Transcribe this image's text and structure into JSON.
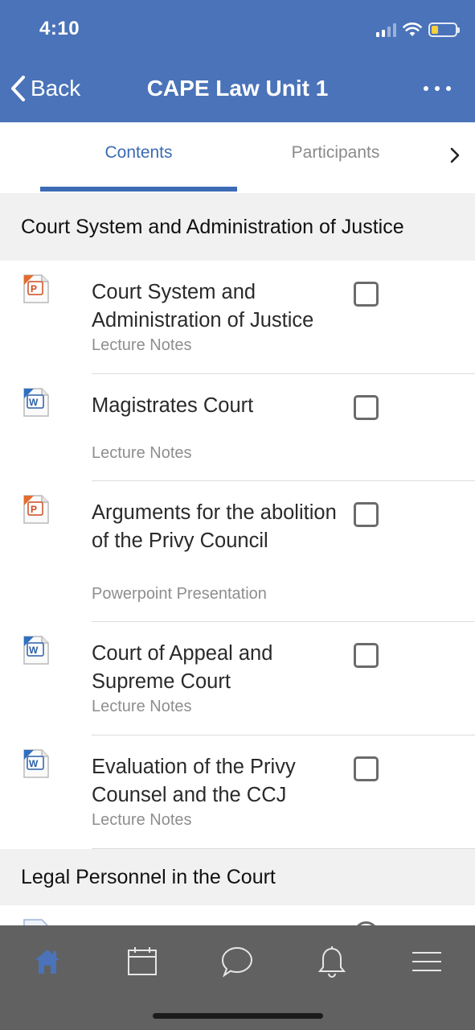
{
  "status_bar": {
    "time": "4:10"
  },
  "header": {
    "back_label": "Back",
    "title": "CAPE Law Unit 1"
  },
  "tabs": [
    {
      "label": "Contents",
      "active": true
    },
    {
      "label": "Participants",
      "active": false
    }
  ],
  "colors": {
    "header": "#4a73b9",
    "accent": "#3b6bb4",
    "bottom_nav": "#616161",
    "active_nav": "#4a73b9"
  },
  "sections": [
    {
      "title": "Court System and Administration of Justice",
      "items": [
        {
          "icon": "powerpoint-file-icon",
          "title": "Court System and Administration of Justice",
          "subtitle": "Lecture Notes",
          "checked": false
        },
        {
          "icon": "word-file-icon",
          "title": "Magistrates Court",
          "subtitle": "Lecture Notes",
          "checked": false
        },
        {
          "icon": "powerpoint-file-icon",
          "title": "Arguments for the abolition of the Privy Council",
          "subtitle": "Powerpoint Presentation",
          "checked": false
        },
        {
          "icon": "word-file-icon",
          "title": "Court of Appeal and Supreme Court",
          "subtitle": "Lecture Notes",
          "checked": false
        },
        {
          "icon": "word-file-icon",
          "title": "Evaluation of the Privy Counsel and the CCJ",
          "subtitle": "Lecture Notes",
          "checked": false
        }
      ]
    },
    {
      "title": "Legal Personnel in the Court"
    }
  ],
  "bottom_nav": [
    {
      "icon": "home-icon",
      "active": true
    },
    {
      "icon": "calendar-icon",
      "active": false
    },
    {
      "icon": "chat-icon",
      "active": false
    },
    {
      "icon": "bell-icon",
      "active": false
    },
    {
      "icon": "menu-icon",
      "active": false
    }
  ]
}
